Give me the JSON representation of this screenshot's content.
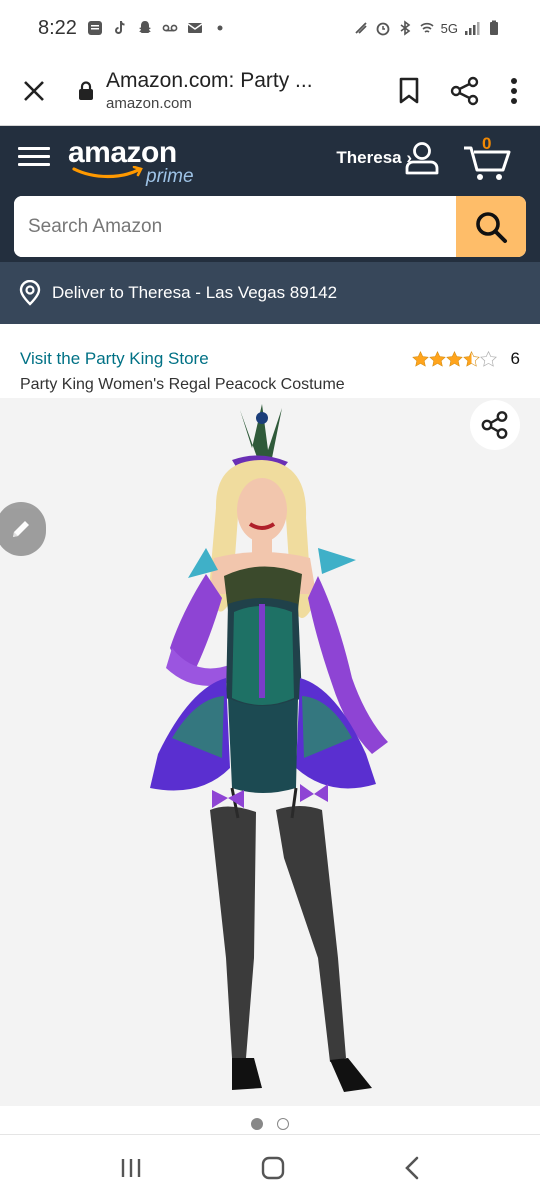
{
  "status_bar": {
    "time": "8:22",
    "network": "5G"
  },
  "browser": {
    "page_title": "Amazon.com: Party ...",
    "domain": "amazon.com"
  },
  "header": {
    "logo_text": "amazon",
    "logo_sub": "prime",
    "account_label": "Theresa ›",
    "cart_count": "0",
    "search_placeholder": "Search Amazon",
    "deliver_text": "Deliver to Theresa - Las Vegas 89142"
  },
  "product": {
    "store_link": "Visit the Party King Store",
    "rating_value": 3.5,
    "rating_count": "6",
    "title": "Party King Women's Regal Peacock Costume",
    "image_count": 2,
    "image_index": 1
  },
  "colors": {
    "header_bg": "#232f3e",
    "deliver_bg": "#37475a",
    "search_button": "#febd69",
    "link": "#007185",
    "cart_count": "#f08804",
    "star": "#ffa41c"
  },
  "icons": {
    "close": "close-icon",
    "lock": "lock-icon",
    "bookmark": "bookmark-icon",
    "share": "share-icon",
    "more": "more-vert-icon",
    "menu": "hamburger-icon",
    "account": "account-icon",
    "cart": "cart-icon",
    "search": "search-icon",
    "location": "location-pin-icon",
    "edit": "pencil-icon"
  }
}
